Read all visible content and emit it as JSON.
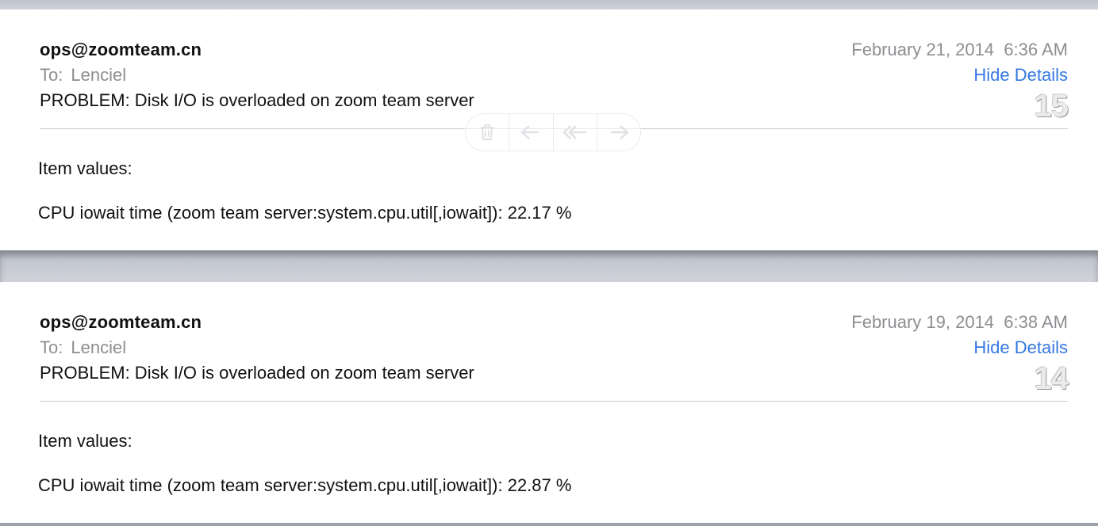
{
  "emails": [
    {
      "sender": "ops@zoomteam.cn",
      "to_label": "To:",
      "to": "Lenciel",
      "subject": "PROBLEM: Disk I/O is overloaded on zoom team server",
      "date": "February 21, 2014  6:36 AM",
      "hide_details": "Hide Details",
      "number": "15",
      "item_label": "Item values:",
      "item_value": "CPU iowait time (zoom team server:system.cpu.util[,iowait]): 22.17 %"
    },
    {
      "sender": "ops@zoomteam.cn",
      "to_label": "To:",
      "to": "Lenciel",
      "subject": "PROBLEM: Disk I/O is overloaded on zoom team server",
      "date": "February 19, 2014  6:38 AM",
      "hide_details": "Hide Details",
      "number": "14",
      "item_label": "Item values:",
      "item_value": "CPU iowait time (zoom team server:system.cpu.util[,iowait]): 22.87 %"
    }
  ],
  "toolbar": {
    "icons": [
      "trash-icon",
      "reply-icon",
      "reply-all-icon",
      "forward-icon"
    ]
  },
  "colors": {
    "link": "#3478e0",
    "muted_text": "#8e8e93",
    "background": "#c7cbd3"
  }
}
